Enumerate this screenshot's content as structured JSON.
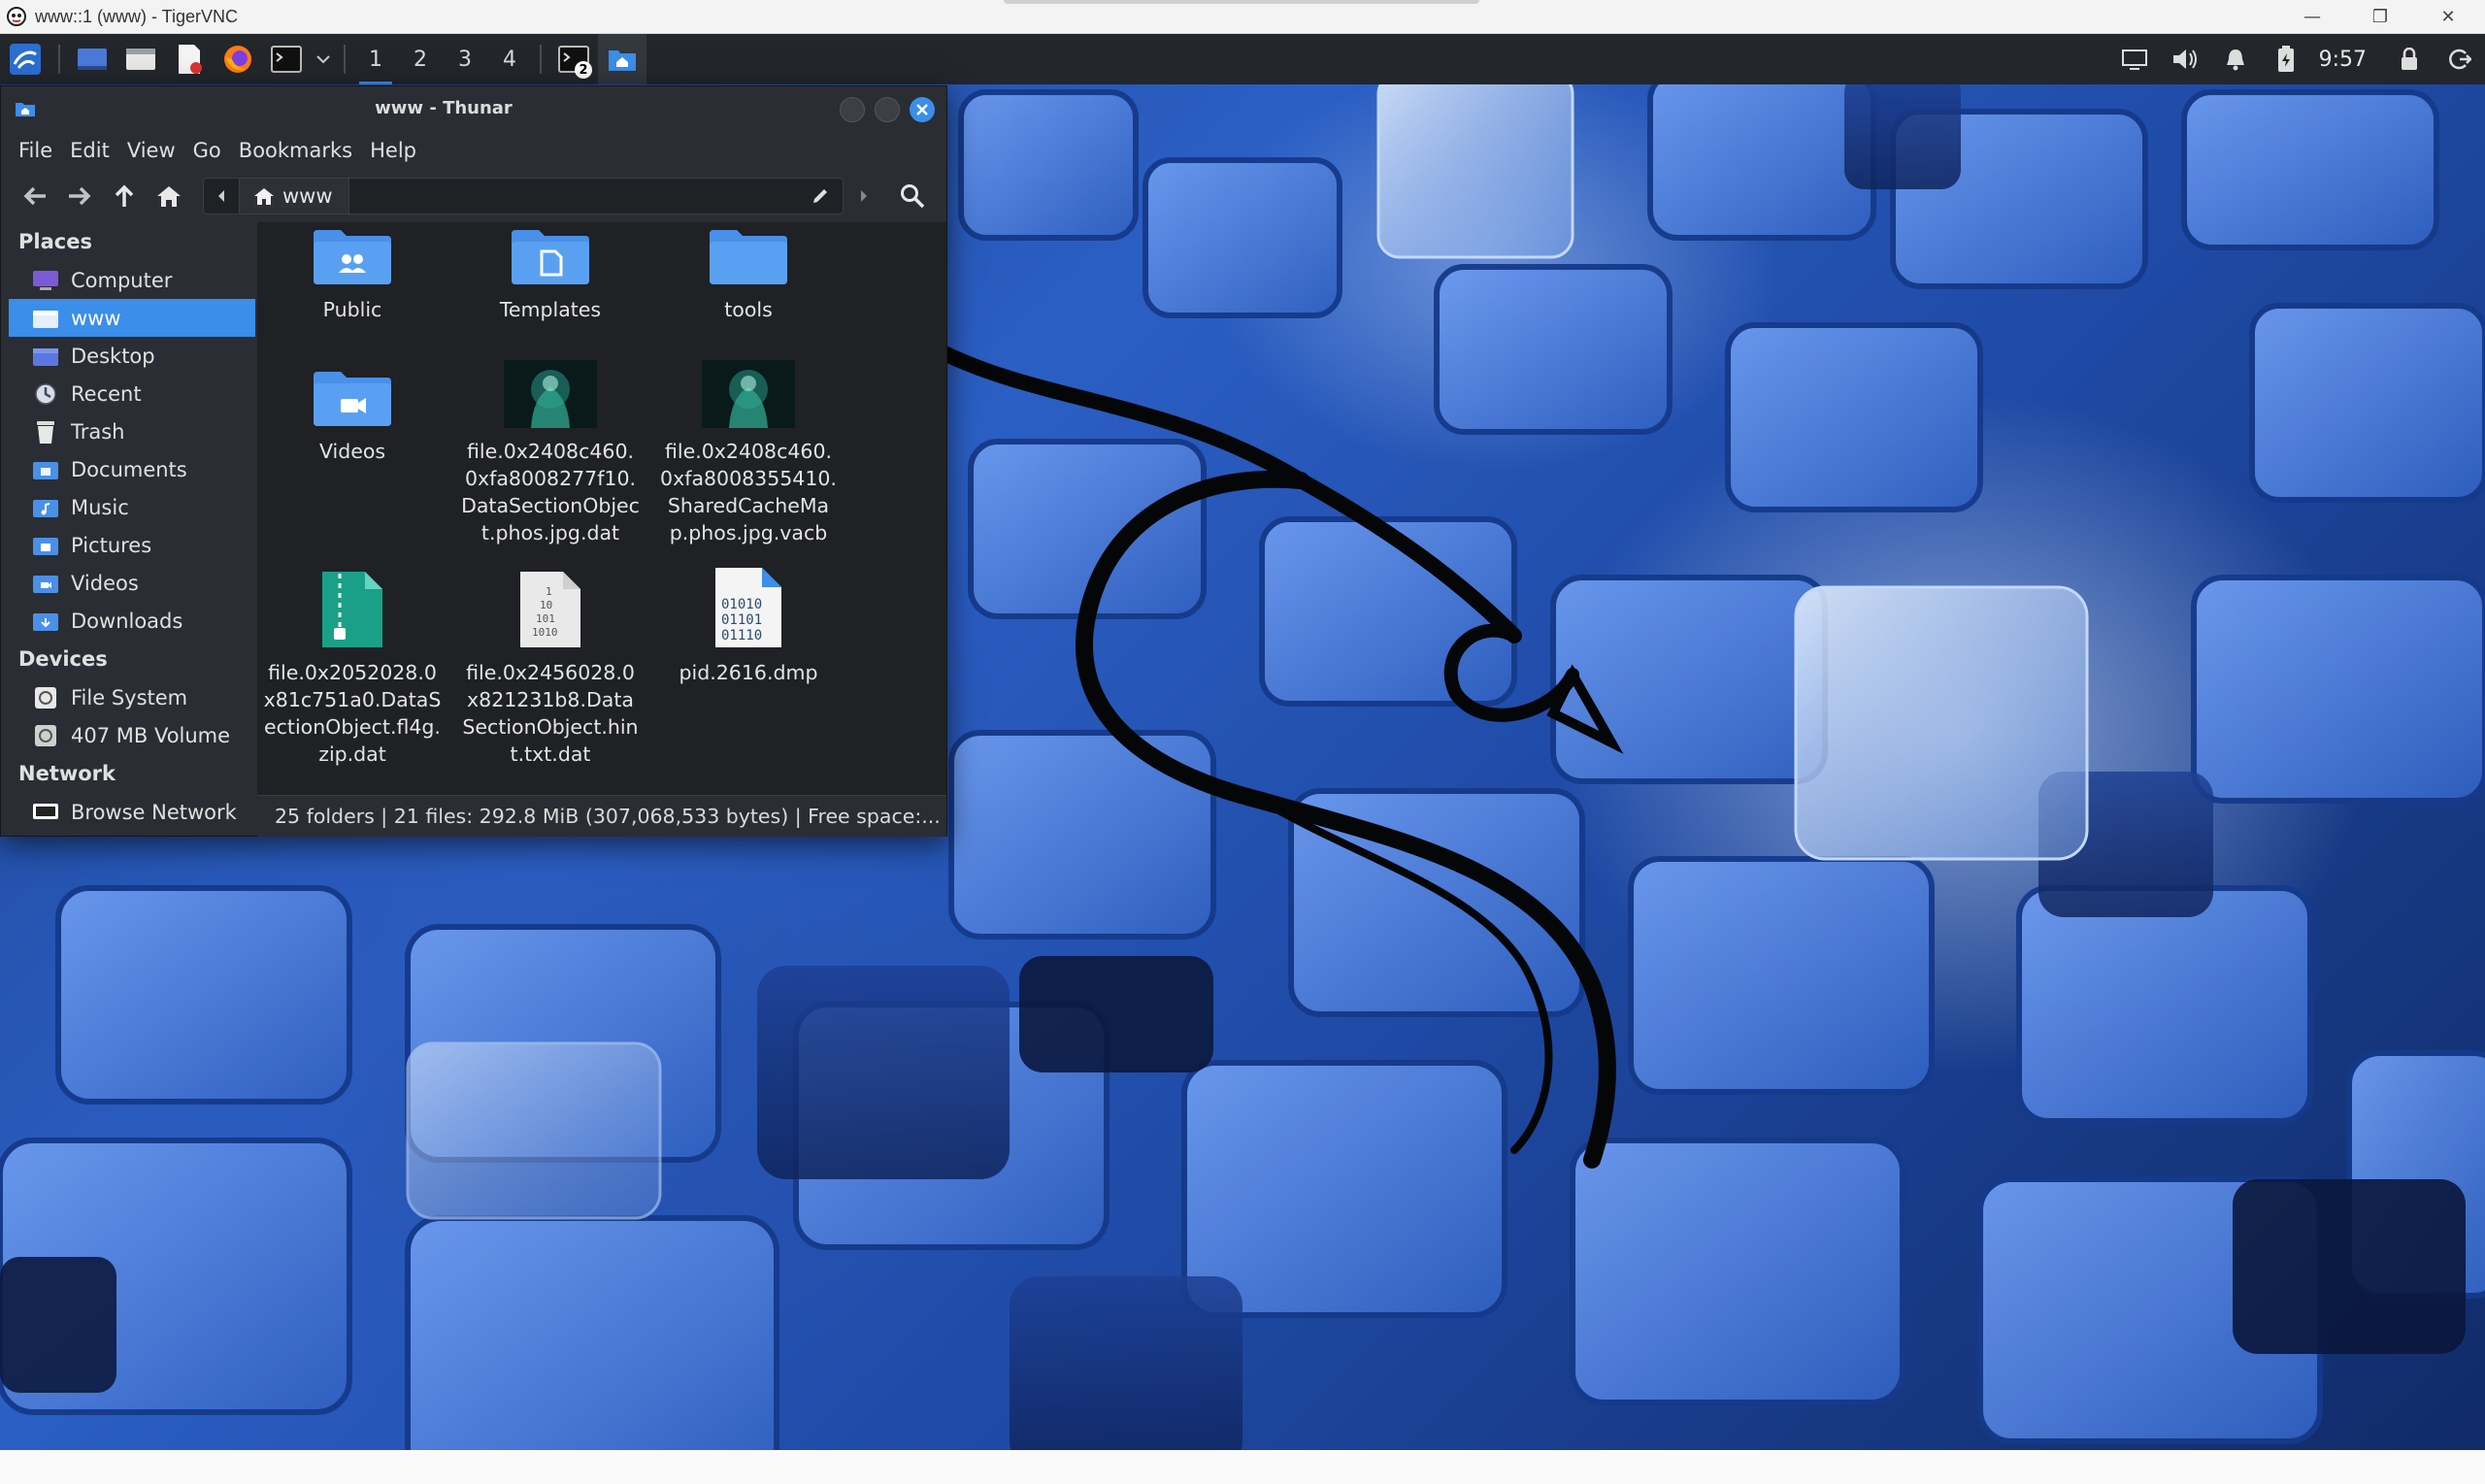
{
  "vnc": {
    "title": "www::1 (www) - TigerVNC",
    "controls": {
      "minimize": "—",
      "maximize": "❐",
      "close": "✕"
    }
  },
  "panel": {
    "workspaces": [
      "1",
      "2",
      "3",
      "4"
    ],
    "active_workspace": "1",
    "clock": "9:57",
    "launchers": [
      "kali-menu-icon",
      "desktop-icon",
      "file-manager-icon",
      "text-editor-icon",
      "firefox-icon",
      "terminal-icon"
    ],
    "tray": [
      "display-icon",
      "volume-icon",
      "notification-bell-icon",
      "battery-icon",
      "lock-icon",
      "logout-icon"
    ],
    "window_badge": "2"
  },
  "thunar": {
    "title": "www - Thunar",
    "menu": [
      "File",
      "Edit",
      "View",
      "Go",
      "Bookmarks",
      "Help"
    ],
    "location": {
      "segment": "www"
    },
    "sidebar": {
      "places_header": "Places",
      "places": [
        {
          "label": "Computer",
          "icon": "computer-icon"
        },
        {
          "label": "www",
          "icon": "home-folder-icon",
          "selected": true
        },
        {
          "label": "Desktop",
          "icon": "desktop-folder-icon"
        },
        {
          "label": "Recent",
          "icon": "recent-icon"
        },
        {
          "label": "Trash",
          "icon": "trash-icon"
        },
        {
          "label": "Documents",
          "icon": "documents-folder-icon"
        },
        {
          "label": "Music",
          "icon": "music-folder-icon"
        },
        {
          "label": "Pictures",
          "icon": "pictures-folder-icon"
        },
        {
          "label": "Videos",
          "icon": "videos-folder-icon"
        },
        {
          "label": "Downloads",
          "icon": "downloads-folder-icon"
        }
      ],
      "devices_header": "Devices",
      "devices": [
        {
          "label": "File System",
          "icon": "drive-icon"
        },
        {
          "label": "407 MB Volume",
          "icon": "drive-icon"
        }
      ],
      "network_header": "Network",
      "network": [
        {
          "label": "Browse Network",
          "icon": "network-icon"
        }
      ]
    },
    "files": [
      {
        "name": "Public",
        "type": "folder-public"
      },
      {
        "name": "Templates",
        "type": "folder-templates"
      },
      {
        "name": "tools",
        "type": "folder"
      },
      {
        "name": "Videos",
        "type": "folder-videos"
      },
      {
        "name": "file.0x2408c460.0xfa8008277f10.DataSectionObject.phos.jpg.dat",
        "type": "image-thumb"
      },
      {
        "name": "file.0x2408c460.0xfa8008355410.SharedCacheMap.phos.jpg.vacb",
        "type": "image-thumb"
      },
      {
        "name": "file.0x2052028.0x81c751a0.DataSectionObject.fl4g.zip.dat",
        "type": "archive"
      },
      {
        "name": "file.0x2456028.0x821231b8.DataSectionObject.hint.txt.dat",
        "type": "binary-doc"
      },
      {
        "name": "pid.2616.dmp",
        "type": "binary-blue"
      }
    ],
    "status": "25 folders  |  21 files: 292.8 MiB (307,068,533 bytes)  |  Free space:..."
  },
  "colors": {
    "accent": "#3b8eea",
    "panel_bg": "#23262b",
    "window_bg": "#2a2d33",
    "view_bg": "#1f2125",
    "folder_blue": "#4a90e8"
  }
}
